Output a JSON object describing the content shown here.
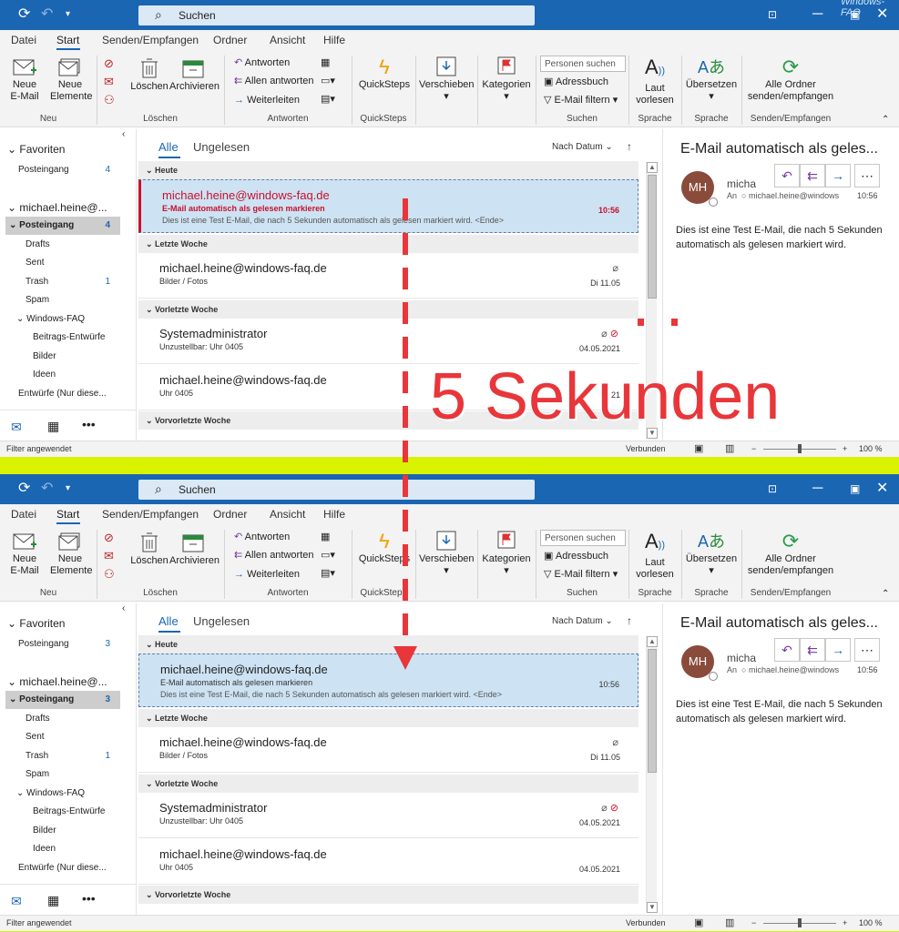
{
  "watermark": "Windows-FAQ",
  "annotation": {
    "text": "5 Sekunden",
    "color": "#e8363a"
  },
  "accent": "#1a66b3",
  "unread_color": "#c8102e",
  "search": {
    "label": "Suchen"
  },
  "menu": [
    "Datei",
    "Start",
    "Senden/Empfangen",
    "Ordner",
    "Ansicht",
    "Hilfe"
  ],
  "ribbon": {
    "new_email": "Neue\nE-Mail",
    "new_items": "Neue\nElemente",
    "delete": "Löschen",
    "archive": "Archivieren",
    "reply": "Antworten",
    "reply_all": "Allen antworten",
    "forward": "Weiterleiten",
    "quicksteps": "QuickSteps",
    "move": "Verschieben",
    "categories": "Kategorien",
    "person_search": "Personen suchen",
    "address_book": "Adressbuch",
    "filter_email": "E-Mail filtern",
    "read_aloud": "Laut\nvorlesen",
    "translate": "Übersetzen",
    "sync": "Alle Ordner\nsenden/empfangen",
    "groups": [
      "Neu",
      "Löschen",
      "Antworten",
      "QuickSteps",
      "Suchen",
      "Sprache",
      "Sprache",
      "Senden/Empfangen"
    ]
  },
  "nav": {
    "favorites": "Favoriten",
    "inbox": "Posteingang",
    "account": "michael.heine@...",
    "folders": [
      {
        "label": "Drafts",
        "count": ""
      },
      {
        "label": "Sent",
        "count": ""
      },
      {
        "label": "Trash",
        "count": "1"
      },
      {
        "label": "Spam",
        "count": ""
      }
    ],
    "sub": "Windows-FAQ",
    "subfolders": [
      "Beitrags-Entwürfe",
      "Bilder",
      "Ideen"
    ],
    "drafts_more": "Entwürfe (Nur diese..."
  },
  "list": {
    "tabs": [
      "Alle",
      "Ungelesen"
    ],
    "sort": "Nach Datum",
    "groups": [
      "Heute",
      "Letzte Woche",
      "Vorletzte Woche",
      "Vorvorletzte Woche"
    ],
    "mails": [
      {
        "sender": "michael.heine@windows-faq.de",
        "subject": "E-Mail automatisch als gelesen markieren",
        "preview": "Dies ist eine Test E-Mail, die nach 5 Sekunden automatisch als gelesen markiert wird. <Ende>",
        "time": "10:56"
      },
      {
        "sender": "michael.heine@windows-faq.de",
        "subject": "Bilder / Fotos",
        "preview": "",
        "time": "Di 11.05"
      },
      {
        "sender": "Systemadministrator",
        "subject": "Unzustellbar: Uhr 0405",
        "preview": "",
        "time": "04.05.2021"
      },
      {
        "sender": "michael.heine@windows-faq.de",
        "subject": "Uhr 0405",
        "preview": "",
        "time": "04.05.2021"
      }
    ]
  },
  "reading": {
    "title": "E-Mail automatisch als geles...",
    "initials": "MH",
    "name": "micha",
    "to_label": "An",
    "to": "michael.heine@windows",
    "time": "10:56",
    "body": "Dies ist eine Test E-Mail, die nach 5 Sekunden automatisch als gelesen markiert wird."
  },
  "status": {
    "filter": "Filter angewendet",
    "connected": "Verbunden",
    "zoom": "100 %"
  },
  "panels": [
    {
      "inbox_count": "4",
      "state": "unread",
      "time4": "21"
    },
    {
      "inbox_count": "3",
      "state": "read",
      "time4": "04.05.2021"
    }
  ]
}
